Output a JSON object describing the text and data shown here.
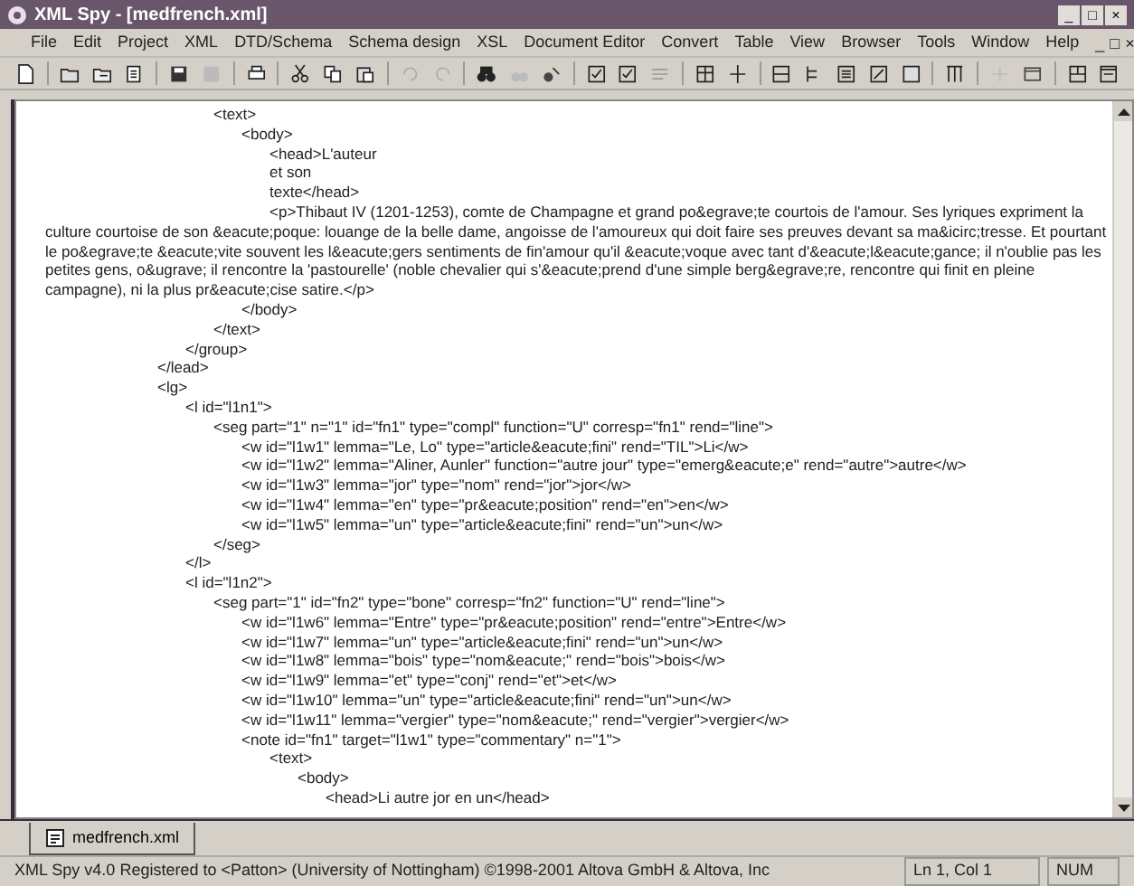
{
  "window": {
    "title": "XML Spy - [medfrench.xml]",
    "controls": [
      "_",
      "□",
      "×"
    ]
  },
  "menu": [
    "File",
    "Edit",
    "Project",
    "XML",
    "DTD/Schema",
    "Schema design",
    "XSL",
    "Document Editor",
    "Convert",
    "Table",
    "View",
    "Browser",
    "Tools",
    "Window",
    "Help"
  ],
  "doc_controls": [
    "_",
    "□",
    "×"
  ],
  "editor": {
    "lines": [
      "\t\t\t\t\t\t<text>",
      "\t\t\t\t\t\t\t<body>",
      "\t\t\t\t\t\t\t\t<head>L'auteur",
      "\t\t\t\t\t\t\t\tet son",
      "\t\t\t\t\t\t\t\ttexte</head>",
      "\t\t\t\t\t\t\t\t<p>Thibaut IV (1201-1253), comte de Champagne et grand po&egrave;te courtois de l'amour. Ses lyriques expriment la culture courtoise de son &eacute;poque: louange de la belle dame, angoisse de l'amoureux qui doit faire ses preuves devant sa ma&icirc;tresse. Et pourtant le po&egrave;te &eacute;vite souvent les l&eacute;gers sentiments de fin'amour qu'il &eacute;voque avec tant d'&eacute;l&eacute;gance; il n'oublie pas les petites gens, o&ugrave; il rencontre la 'pastourelle' (noble chevalier qui s'&eacute;prend d'une simple berg&egrave;re, rencontre qui finit en pleine campagne), ni la plus pr&eacute;cise satire.</p>",
      "\t\t\t\t\t\t\t</body>",
      "\t\t\t\t\t\t</text>",
      "\t\t\t\t\t</group>",
      "\t\t\t\t</lead>",
      "\t\t\t\t<lg>",
      "\t\t\t\t\t<l id=\"l1n1\">",
      "\t\t\t\t\t\t<seg part=\"1\" n=\"1\" id=\"fn1\" type=\"compl\" function=\"U\" corresp=\"fn1\" rend=\"line\">",
      "\t\t\t\t\t\t\t<w id=\"l1w1\" lemma=\"Le, Lo\" type=\"article&eacute;fini\" rend=\"TIL\">Li</w>",
      "\t\t\t\t\t\t\t<w id=\"l1w2\" lemma=\"Aliner, Aunler\" function=\"autre jour\" type=\"emerg&eacute;e\" rend=\"autre\">autre</w>",
      "\t\t\t\t\t\t\t<w id=\"l1w3\" lemma=\"jor\" type=\"nom\" rend=\"jor\">jor</w>",
      "\t\t\t\t\t\t\t<w id=\"l1w4\" lemma=\"en\" type=\"pr&eacute;position\" rend=\"en\">en</w>",
      "\t\t\t\t\t\t\t<w id=\"l1w5\" lemma=\"un\" type=\"article&eacute;fini\" rend=\"un\">un</w>",
      "\t\t\t\t\t\t</seg>",
      "\t\t\t\t\t</l>",
      "\t\t\t\t\t<l id=\"l1n2\">",
      "\t\t\t\t\t\t<seg part=\"1\" id=\"fn2\" type=\"bone\" corresp=\"fn2\" function=\"U\" rend=\"line\">",
      "\t\t\t\t\t\t\t<w id=\"l1w6\" lemma=\"Entre\" type=\"pr&eacute;position\" rend=\"entre\">Entre</w>",
      "\t\t\t\t\t\t\t<w id=\"l1w7\" lemma=\"un\" type=\"article&eacute;fini\" rend=\"un\">un</w>",
      "\t\t\t\t\t\t\t<w id=\"l1w8\" lemma=\"bois\" type=\"nom&eacute;\" rend=\"bois\">bois</w>",
      "\t\t\t\t\t\t\t<w id=\"l1w9\" lemma=\"et\" type=\"conj\" rend=\"et\">et</w>",
      "\t\t\t\t\t\t\t<w id=\"l1w10\" lemma=\"un\" type=\"article&eacute;fini\" rend=\"un\">un</w>",
      "\t\t\t\t\t\t\t<w id=\"l1w11\" lemma=\"vergier\" type=\"nom&eacute;\" rend=\"vergier\">vergier</w>",
      "\t\t\t\t\t\t\t<note id=\"fn1\" target=\"l1w1\" type=\"commentary\" n=\"1\">",
      "\t\t\t\t\t\t\t\t<text>",
      "\t\t\t\t\t\t\t\t\t<body>",
      "\t\t\t\t\t\t\t\t\t\t<head>Li autre jor en un</head>"
    ]
  },
  "doc_tab": {
    "label": "medfrench.xml",
    "selected": true
  },
  "status_bar": {
    "message": "XML Spy v4.0 Registered to <Patton> (University of Nottingham) ©1998-2001 Altova GmbH & Altova, Inc",
    "position": "Ln 1, Col 1",
    "num": "NUM"
  }
}
